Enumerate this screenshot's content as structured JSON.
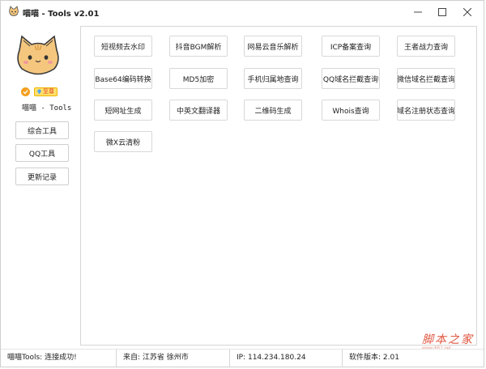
{
  "window": {
    "title": "喵喵 - Tools v2.01"
  },
  "sidebar": {
    "badge_vip": "至尊",
    "username": "喵喵 - Tools",
    "nav": [
      {
        "label": "综合工具"
      },
      {
        "label": "QQ工具"
      },
      {
        "label": "更新记录"
      }
    ]
  },
  "tools": [
    {
      "label": "短视频去水印"
    },
    {
      "label": "抖音BGM解析"
    },
    {
      "label": "网易云音乐解析"
    },
    {
      "label": "ICP备案查询"
    },
    {
      "label": "王者战力查询"
    },
    {
      "label": "Base64编码转换"
    },
    {
      "label": "MD5加密"
    },
    {
      "label": "手机归属地查询"
    },
    {
      "label": "QQ域名拦截查询"
    },
    {
      "label": "微信域名拦截查询"
    },
    {
      "label": "短网址生成"
    },
    {
      "label": "中英文翻译器"
    },
    {
      "label": "二维码生成"
    },
    {
      "label": "Whois查询"
    },
    {
      "label": "域名注册状态查询"
    },
    {
      "label": "微X云清粉"
    }
  ],
  "status": {
    "connection": "喵喵Tools: 连接成功!",
    "location": "来自: 江苏省 徐州市",
    "ip": "IP: 114.234.180.24",
    "version": "软件版本: 2.01"
  },
  "watermark": {
    "main": "脚本之家",
    "sub": "www.jb51.net"
  },
  "icons": {
    "app": "cat-face-icon",
    "avatar": "cat-face-avatar",
    "check": "checkmark-badge-icon",
    "vip": "diamond-icon",
    "minimize": "minimize-icon",
    "maximize": "maximize-icon",
    "close": "close-icon"
  },
  "colors": {
    "cat_fur": "#f5c77e",
    "cat_cheek": "#f29a9a",
    "badge_orange": "#f4a020",
    "vip_yellow": "#ffe06a",
    "watermark_red": "#e0553f"
  }
}
